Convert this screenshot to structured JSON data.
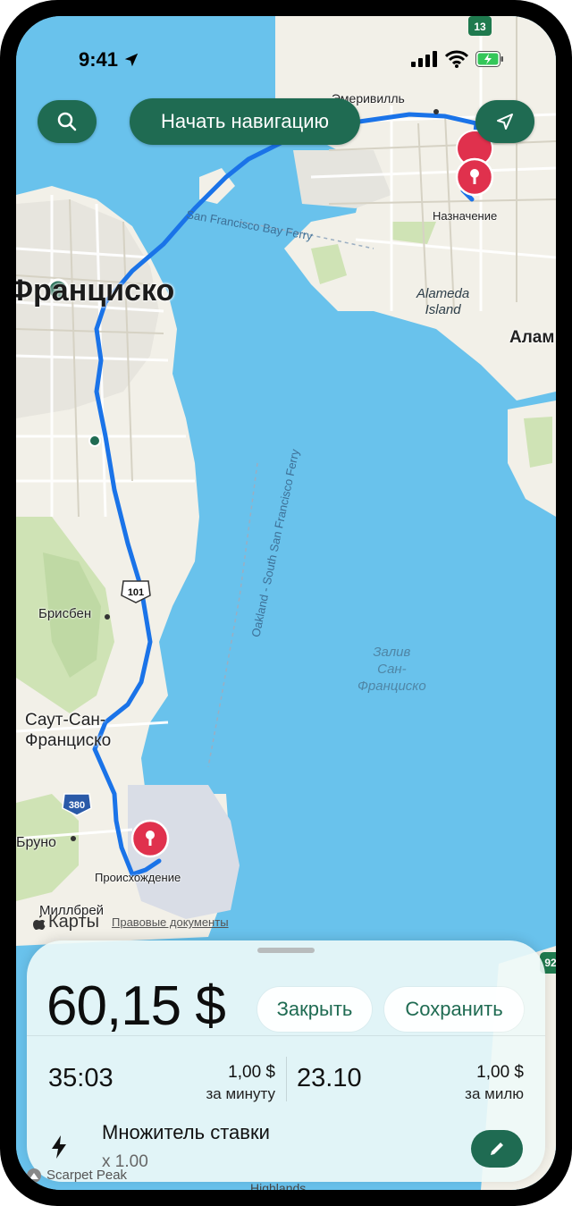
{
  "status_bar": {
    "time": "9:41"
  },
  "top_bar": {
    "start_navigation_label": "Начать навигацию"
  },
  "map": {
    "labels": {
      "emeryville": "Эмеривилль",
      "destination": "Назначение",
      "ferry_bay": "San Francisco Bay Ferry",
      "san_francisco": "Франциско",
      "alameda_island": "Alameda\nIsland",
      "alameda_town": "Алам",
      "ferry_oakland": "Oakland - South San Francisco Ferry",
      "brisbane": "Брисбен",
      "bay": "Залив\nСан-\nФранциско",
      "south_sf": "Саут-Сан-\nФранциско",
      "bruno": "Бруно",
      "origin": "Происхождение",
      "millbrae": "Миллбрей",
      "highlands": "Highlands",
      "scarpet_peak": "Scarpet Peak"
    },
    "shields": {
      "hwy_13": "13",
      "hwy_101": "101",
      "hwy_380": "380",
      "hwy_92": "92"
    },
    "attribution": {
      "maps": "Карты",
      "legal": "Правовые документы"
    },
    "colors": {
      "water": "#69c2ec",
      "land": "#f2f0e8",
      "park": "#cfe3b5",
      "route": "#1a73e8",
      "pin": "#e0314d",
      "accent": "#1f6b52"
    }
  },
  "panel": {
    "price": "60,15 $",
    "close_label": "Закрыть",
    "save_label": "Сохранить",
    "duration": "35:03",
    "per_minute_value": "1,00 $",
    "per_minute_unit": "за минуту",
    "distance": "23.10",
    "per_mile_value": "1,00 $",
    "per_mile_unit": "за милю",
    "multiplier_title": "Множитель ставки",
    "multiplier_value": "x 1.00"
  }
}
